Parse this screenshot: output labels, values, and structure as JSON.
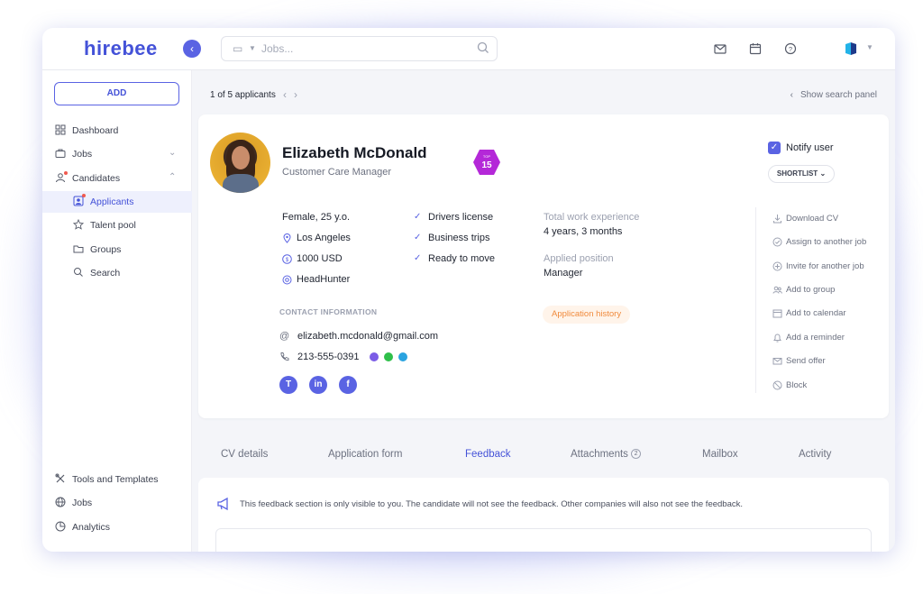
{
  "app": {
    "logo_text": "hirebee"
  },
  "search": {
    "placeholder": "Jobs..."
  },
  "sidebar": {
    "add_label": "ADD",
    "items": [
      {
        "label": "Dashboard"
      },
      {
        "label": "Jobs"
      },
      {
        "label": "Candidates"
      },
      {
        "label": "Applicants"
      },
      {
        "label": "Talent pool"
      },
      {
        "label": "Groups"
      },
      {
        "label": "Search"
      },
      {
        "label": "Tools and Templates"
      },
      {
        "label": "Jobs"
      },
      {
        "label": "Analytics"
      }
    ]
  },
  "pager": {
    "text": "1 of 5 applicants",
    "show_panel": "Show search panel"
  },
  "candidate": {
    "name": "Elizabeth McDonald",
    "role": "Customer Care Manager",
    "badge_top": "TOP",
    "badge_num": "15",
    "notify_label": "Notify user",
    "notify_checked": true,
    "shortlist_label": "SHORTLIST",
    "facts": [
      {
        "text": "Female, 25 y.o."
      },
      {
        "text": "Los Angeles",
        "icon": "location-icon"
      },
      {
        "text": "1000 USD",
        "icon": "dollar-icon"
      },
      {
        "text": "HeadHunter",
        "icon": "target-icon"
      }
    ],
    "checks": [
      {
        "text": "Drivers license"
      },
      {
        "text": "Business trips"
      },
      {
        "text": "Ready to move"
      }
    ],
    "experience_label": "Total work experience",
    "experience_value": "4 years, 3 months",
    "position_label": "Applied position",
    "position_value": "Manager",
    "contact_title": "CONTACT INFORMATION",
    "email": "elizabeth.mcdonald@gmail.com",
    "phone": "213-555-0391",
    "application_history": "Application history",
    "social": [
      "T",
      "in",
      "f"
    ]
  },
  "actions": [
    {
      "label": "Download CV",
      "icon": "download-icon"
    },
    {
      "label": "Assign to another job",
      "icon": "check-circle-icon"
    },
    {
      "label": "Invite for another job",
      "icon": "plus-circle-icon"
    },
    {
      "label": "Add to group",
      "icon": "group-icon"
    },
    {
      "label": "Add to calendar",
      "icon": "calendar-icon"
    },
    {
      "label": "Add a reminder",
      "icon": "bell-icon"
    },
    {
      "label": "Send offer",
      "icon": "mail-icon"
    },
    {
      "label": "Block",
      "icon": "block-icon"
    }
  ],
  "tabs": [
    {
      "label": "CV details"
    },
    {
      "label": "Application form"
    },
    {
      "label": "Feedback"
    },
    {
      "label": "Attachments"
    },
    {
      "label": "Mailbox"
    },
    {
      "label": "Activity"
    }
  ],
  "feedback": {
    "notice": "This feedback section is only visible to you. The candidate will not see the feedback. Other companies will also not see the feedback."
  },
  "colors": {
    "accent": "#5a63e3",
    "brand": "#4452d8",
    "orange": "#f08a3c"
  }
}
